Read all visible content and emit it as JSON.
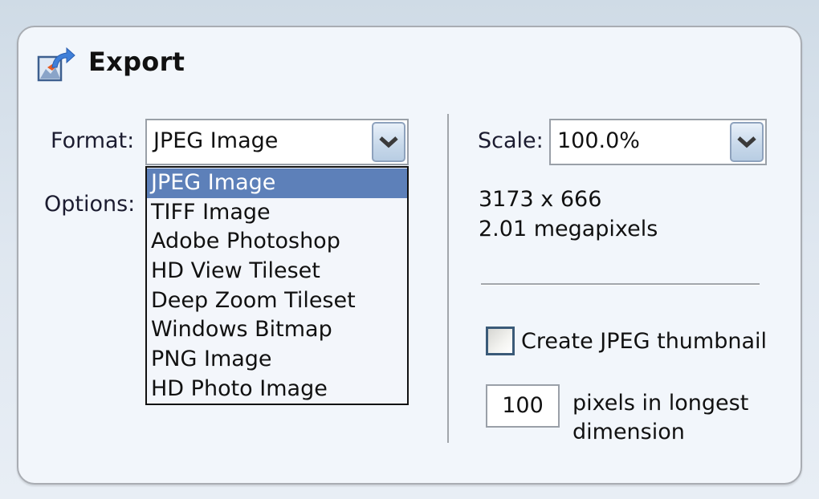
{
  "header": {
    "title": "Export",
    "icon": "export-image-icon"
  },
  "format": {
    "label": "Format:",
    "selected": "JPEG Image",
    "options": [
      "JPEG Image",
      "TIFF Image",
      "Adobe Photoshop",
      "HD View Tileset",
      "Deep Zoom Tileset",
      "Windows Bitmap",
      "PNG Image",
      "HD Photo Image"
    ],
    "highlighted_index": 0
  },
  "options": {
    "label": "Options:"
  },
  "scale": {
    "label": "Scale:",
    "value": "100.0%"
  },
  "dimensions": {
    "size": "3173 x 666",
    "megapixels": "2.01 megapixels"
  },
  "thumbnail": {
    "checkbox_label": "Create JPEG thumbnail",
    "checked": false,
    "size_value": "100",
    "size_label_line1": "pixels in longest",
    "size_label_line2": "dimension"
  },
  "colors": {
    "selection": "#5d80b9",
    "panel_bg": "#f2f6fb"
  }
}
